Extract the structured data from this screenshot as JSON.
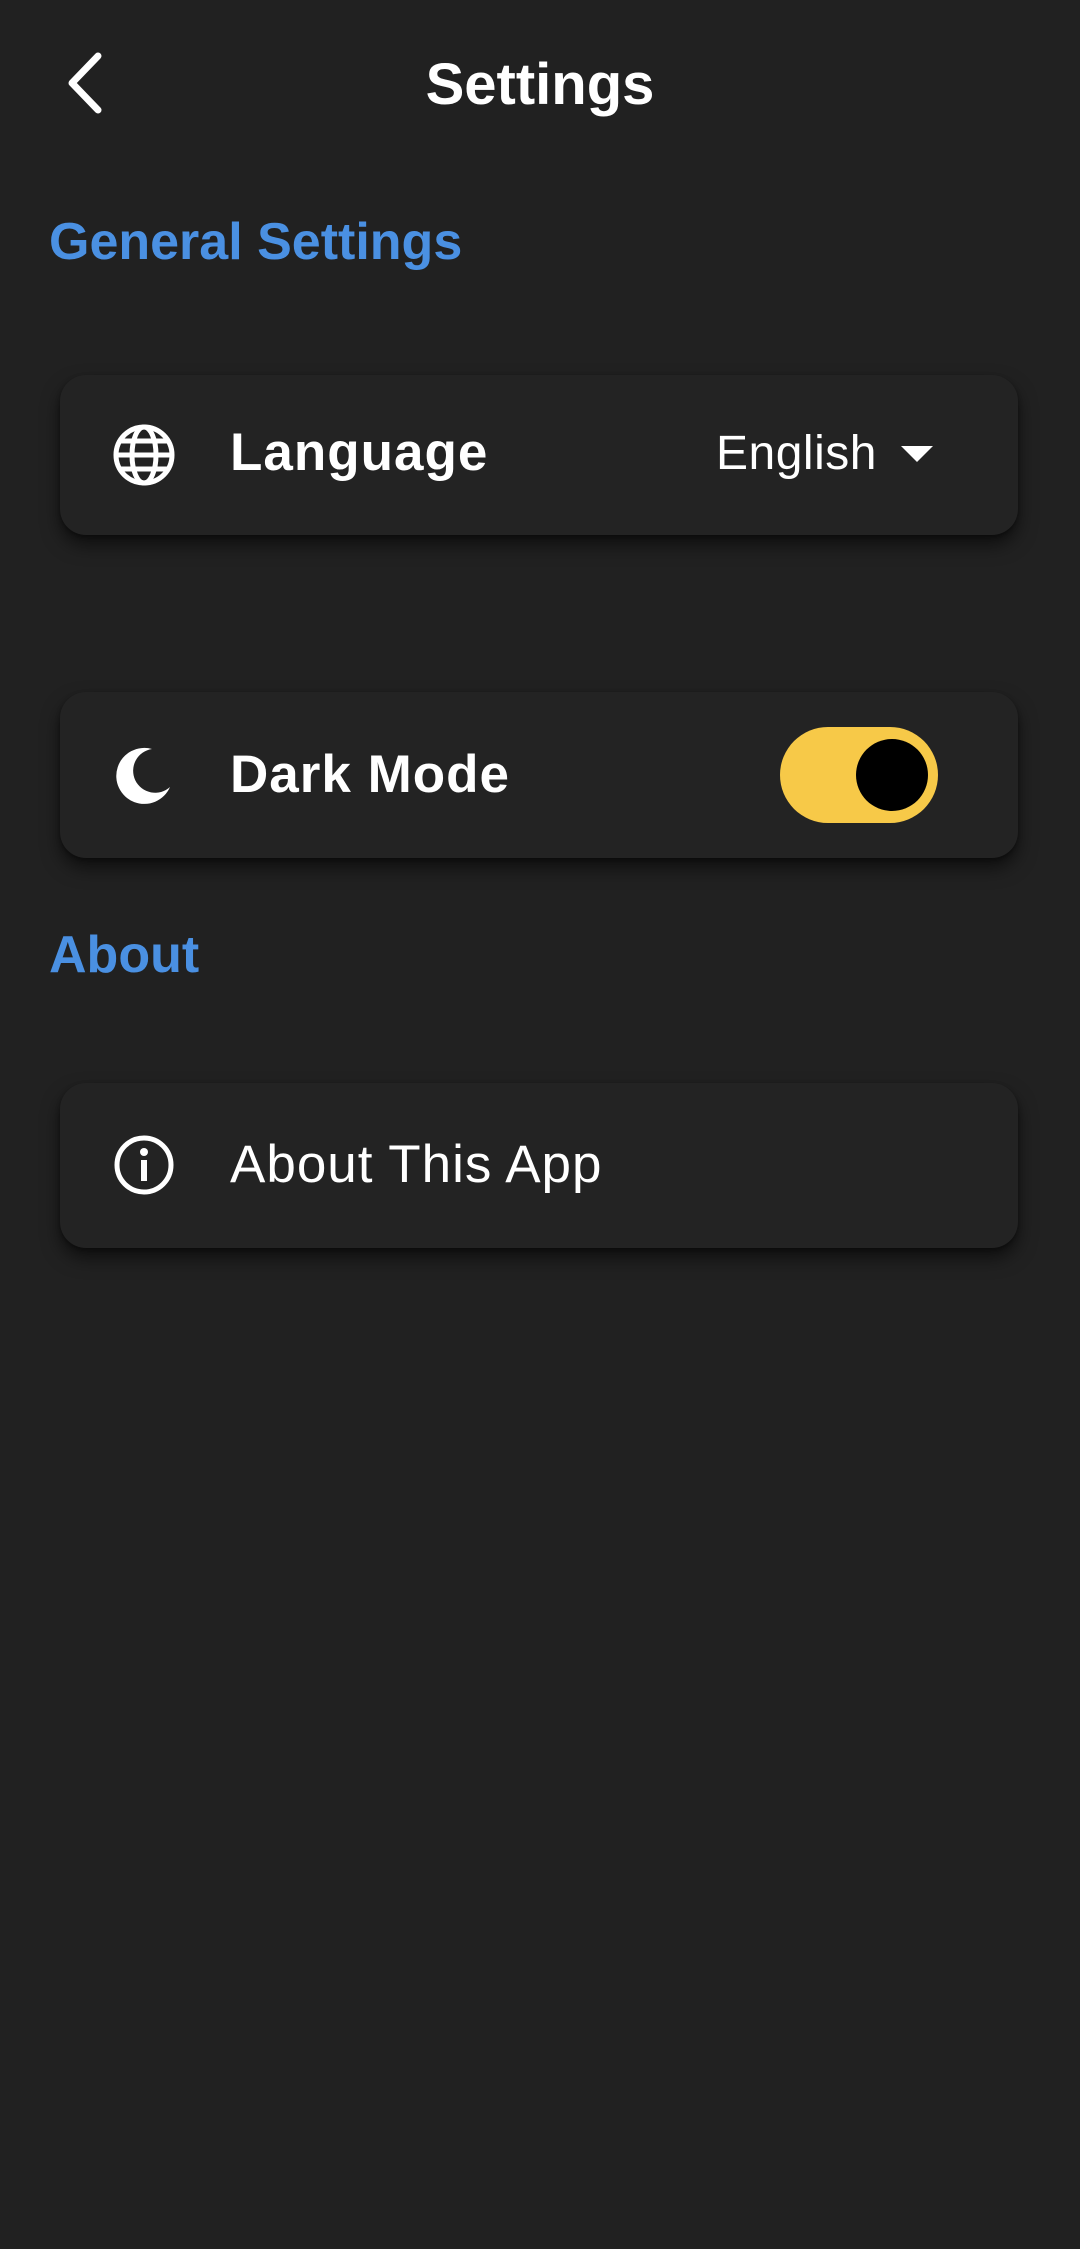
{
  "header": {
    "title": "Settings",
    "back_icon": "chevron-left-icon"
  },
  "sections": {
    "general": {
      "title": "General Settings",
      "language": {
        "label": "Language",
        "icon": "globe-icon",
        "selected_value": "English"
      },
      "dark_mode": {
        "label": "Dark Mode",
        "icon": "moon-icon",
        "enabled": true
      }
    },
    "about": {
      "title": "About",
      "about_app": {
        "label": "About This App",
        "icon": "info-icon"
      }
    }
  },
  "colors": {
    "background": "#212121",
    "card": "#232323",
    "section_header": "#4a90e2",
    "toggle_on": "#f7c948",
    "text": "#ffffff"
  }
}
